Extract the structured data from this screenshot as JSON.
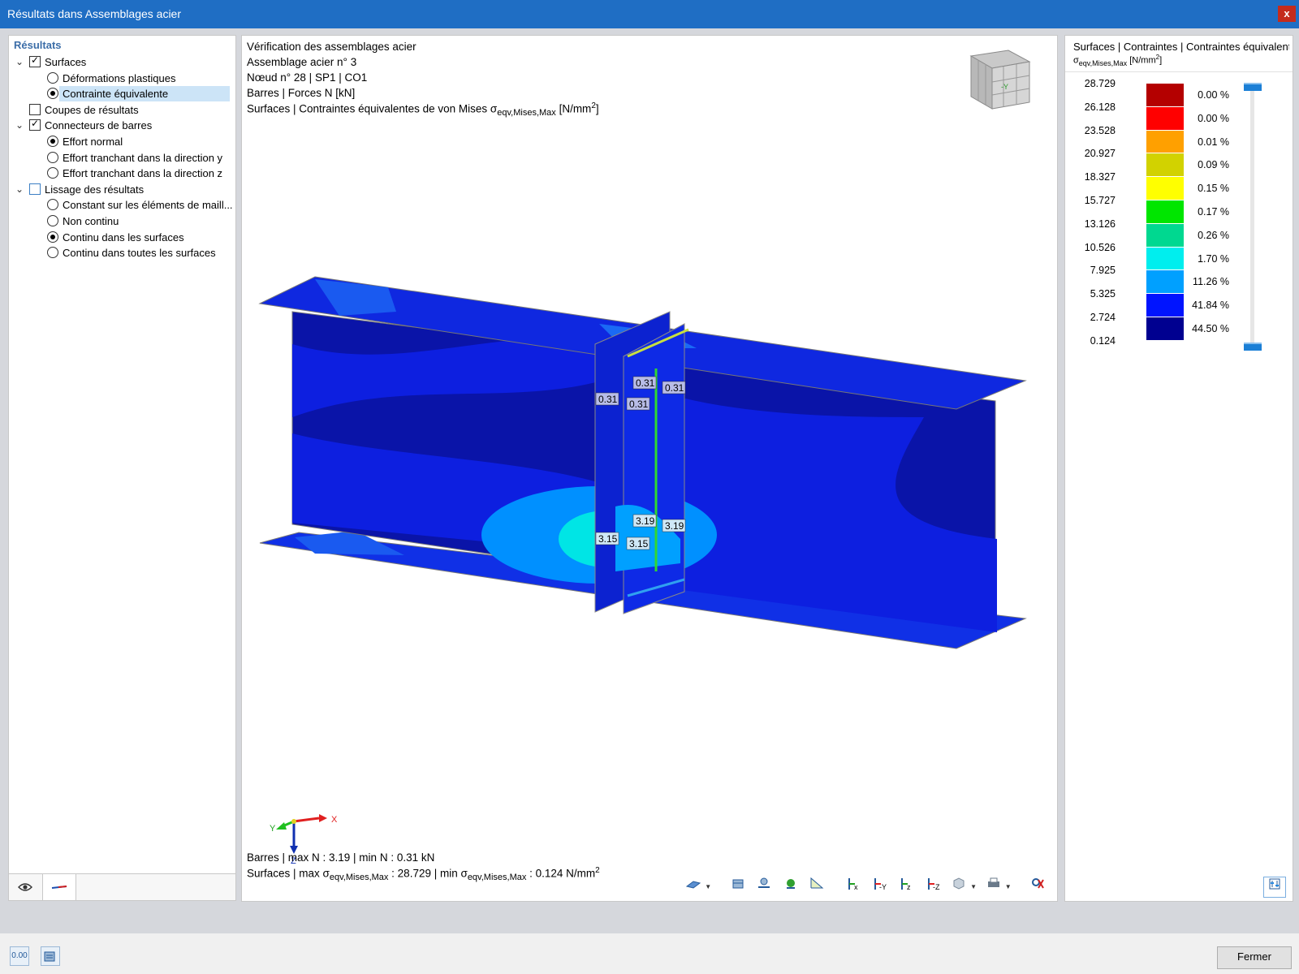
{
  "window": {
    "title": "Résultats dans Assemblages acier",
    "close_label": "x"
  },
  "navigator": {
    "header": "Résultats",
    "items": [
      {
        "label": "Surfaces",
        "type": "checkbox",
        "checked": true,
        "expanded": true,
        "level": 0
      },
      {
        "label": "Déformations plastiques",
        "type": "radio",
        "checked": false,
        "level": 1
      },
      {
        "label": "Contrainte équivalente",
        "type": "radio",
        "checked": true,
        "level": 1,
        "selected": true
      },
      {
        "label": "Coupes de résultats",
        "type": "checkbox",
        "checked": false,
        "level": 0
      },
      {
        "label": "Connecteurs de barres",
        "type": "checkbox",
        "checked": true,
        "expanded": true,
        "level": 0
      },
      {
        "label": "Effort normal",
        "type": "radio",
        "checked": true,
        "level": 1
      },
      {
        "label": "Effort tranchant dans la direction y",
        "type": "radio",
        "checked": false,
        "level": 1
      },
      {
        "label": "Effort tranchant dans la direction z",
        "type": "radio",
        "checked": false,
        "level": 1
      },
      {
        "label": "Lissage des résultats",
        "type": "checkbox",
        "checked": false,
        "partial": true,
        "expanded": true,
        "level": 0
      },
      {
        "label": "Constant sur les éléments de maill...",
        "type": "radio",
        "checked": false,
        "level": 1
      },
      {
        "label": "Non continu",
        "type": "radio",
        "checked": false,
        "level": 1
      },
      {
        "label": "Continu dans les surfaces",
        "type": "radio",
        "checked": true,
        "level": 1
      },
      {
        "label": "Continu dans toutes les surfaces",
        "type": "radio",
        "checked": false,
        "level": 1
      }
    ],
    "tabs": [
      {
        "icon": "eye-icon"
      },
      {
        "icon": "results-icon"
      }
    ]
  },
  "viewport": {
    "info_lines": [
      "Vérification des assemblages acier",
      "Assemblage acier n° 3",
      "Nœud n° 28 | SP1 | CO1",
      "Barres | Forces N [kN]"
    ],
    "info_stress_prefix": "Surfaces | Contraintes équivalentes de von Mises σ",
    "info_stress_sub": "eqv,Mises,Max",
    "info_stress_unit": "[N/mm",
    "info_stress_unit_sup": "2",
    "info_stress_unit_close": "]",
    "bottom_line1": "Barres | max N : 3.19 | min N : 0.31 kN",
    "bottom_line2_a": "Surfaces | max σ",
    "bottom_line2_sub1": "eqv,Mises,Max",
    "bottom_line2_b": " : 28.729 | min σ",
    "bottom_line2_sub2": "eqv,Mises,Max",
    "bottom_line2_c": " : 0.124 N/mm",
    "bottom_line2_sup": "2",
    "value_labels": [
      "0.31",
      "0.31",
      "0.31",
      "0.31",
      "3.19",
      "3.19",
      "3.15",
      "3.15"
    ],
    "axes": {
      "x": "X",
      "y": "Y",
      "z": "Z"
    },
    "cube_label": "-Y"
  },
  "legend": {
    "title": "Surfaces | Contraintes | Contraintes équivalentes",
    "subtitle_sym": "σ",
    "subtitle_sub": "eqv,Mises,Max",
    "subtitle_unit": "[N/mm",
    "subtitle_sup": "2",
    "subtitle_close": "]",
    "values": [
      "28.729",
      "26.128",
      "23.528",
      "20.927",
      "18.327",
      "15.727",
      "13.126",
      "10.526",
      "7.925",
      "5.325",
      "2.724",
      "0.124"
    ],
    "percentages": [
      "0.00 %",
      "0.00 %",
      "0.01 %",
      "0.09 %",
      "0.15 %",
      "0.17 %",
      "0.26 %",
      "1.70 %",
      "11.26 %",
      "41.84 %",
      "44.50 %"
    ],
    "colors": [
      "#b40000",
      "#ff0000",
      "#ffa000",
      "#d2d200",
      "#ffff00",
      "#00e600",
      "#00d890",
      "#00eeee",
      "#00a0ff",
      "#0014ff",
      "#000090"
    ]
  },
  "footer": {
    "close_label": "Fermer",
    "icon1_text": "0.00"
  }
}
